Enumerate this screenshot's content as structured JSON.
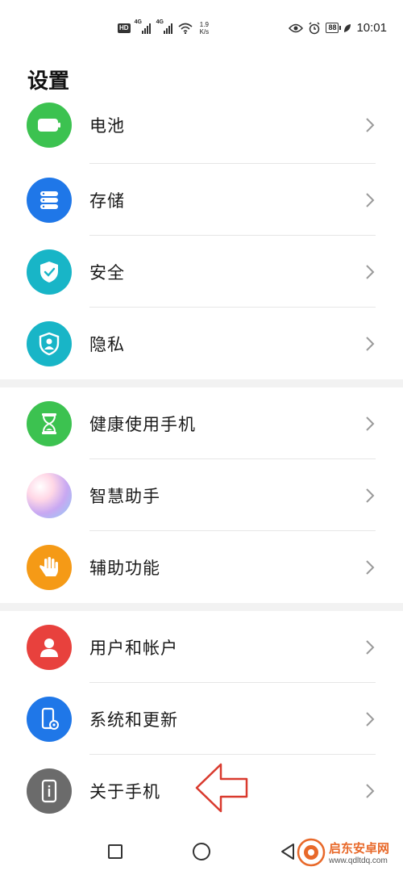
{
  "status_bar": {
    "hd": "HD",
    "net1": "4G",
    "net2": "4G",
    "speed_value": "1.9",
    "speed_unit": "K/s",
    "battery": "88",
    "time": "10:01"
  },
  "page": {
    "title": "设置"
  },
  "groups": [
    {
      "items": [
        {
          "label": "电池",
          "icon": "battery-icon",
          "color": "#3cc250"
        },
        {
          "label": "存储",
          "icon": "storage-icon",
          "color": "#1f77e8"
        },
        {
          "label": "安全",
          "icon": "shield-check-icon",
          "color": "#18b5c7"
        },
        {
          "label": "隐私",
          "icon": "privacy-shield-icon",
          "color": "#18b5c7"
        }
      ]
    },
    {
      "items": [
        {
          "label": "健康使用手机",
          "icon": "hourglass-icon",
          "color": "#3cc250"
        },
        {
          "label": "智慧助手",
          "icon": "assistant-orb-icon",
          "color": "#c9a6f0"
        },
        {
          "label": "辅助功能",
          "icon": "hand-icon",
          "color": "#f59a16"
        }
      ]
    },
    {
      "items": [
        {
          "label": "用户和帐户",
          "icon": "user-icon",
          "color": "#e8413d"
        },
        {
          "label": "系统和更新",
          "icon": "phone-gear-icon",
          "color": "#1f77e8"
        },
        {
          "label": "关于手机",
          "icon": "phone-info-icon",
          "color": "#6b6b6b"
        }
      ]
    }
  ],
  "watermark": {
    "main": "启东安卓网",
    "sub": "www.qdltdq.com"
  }
}
